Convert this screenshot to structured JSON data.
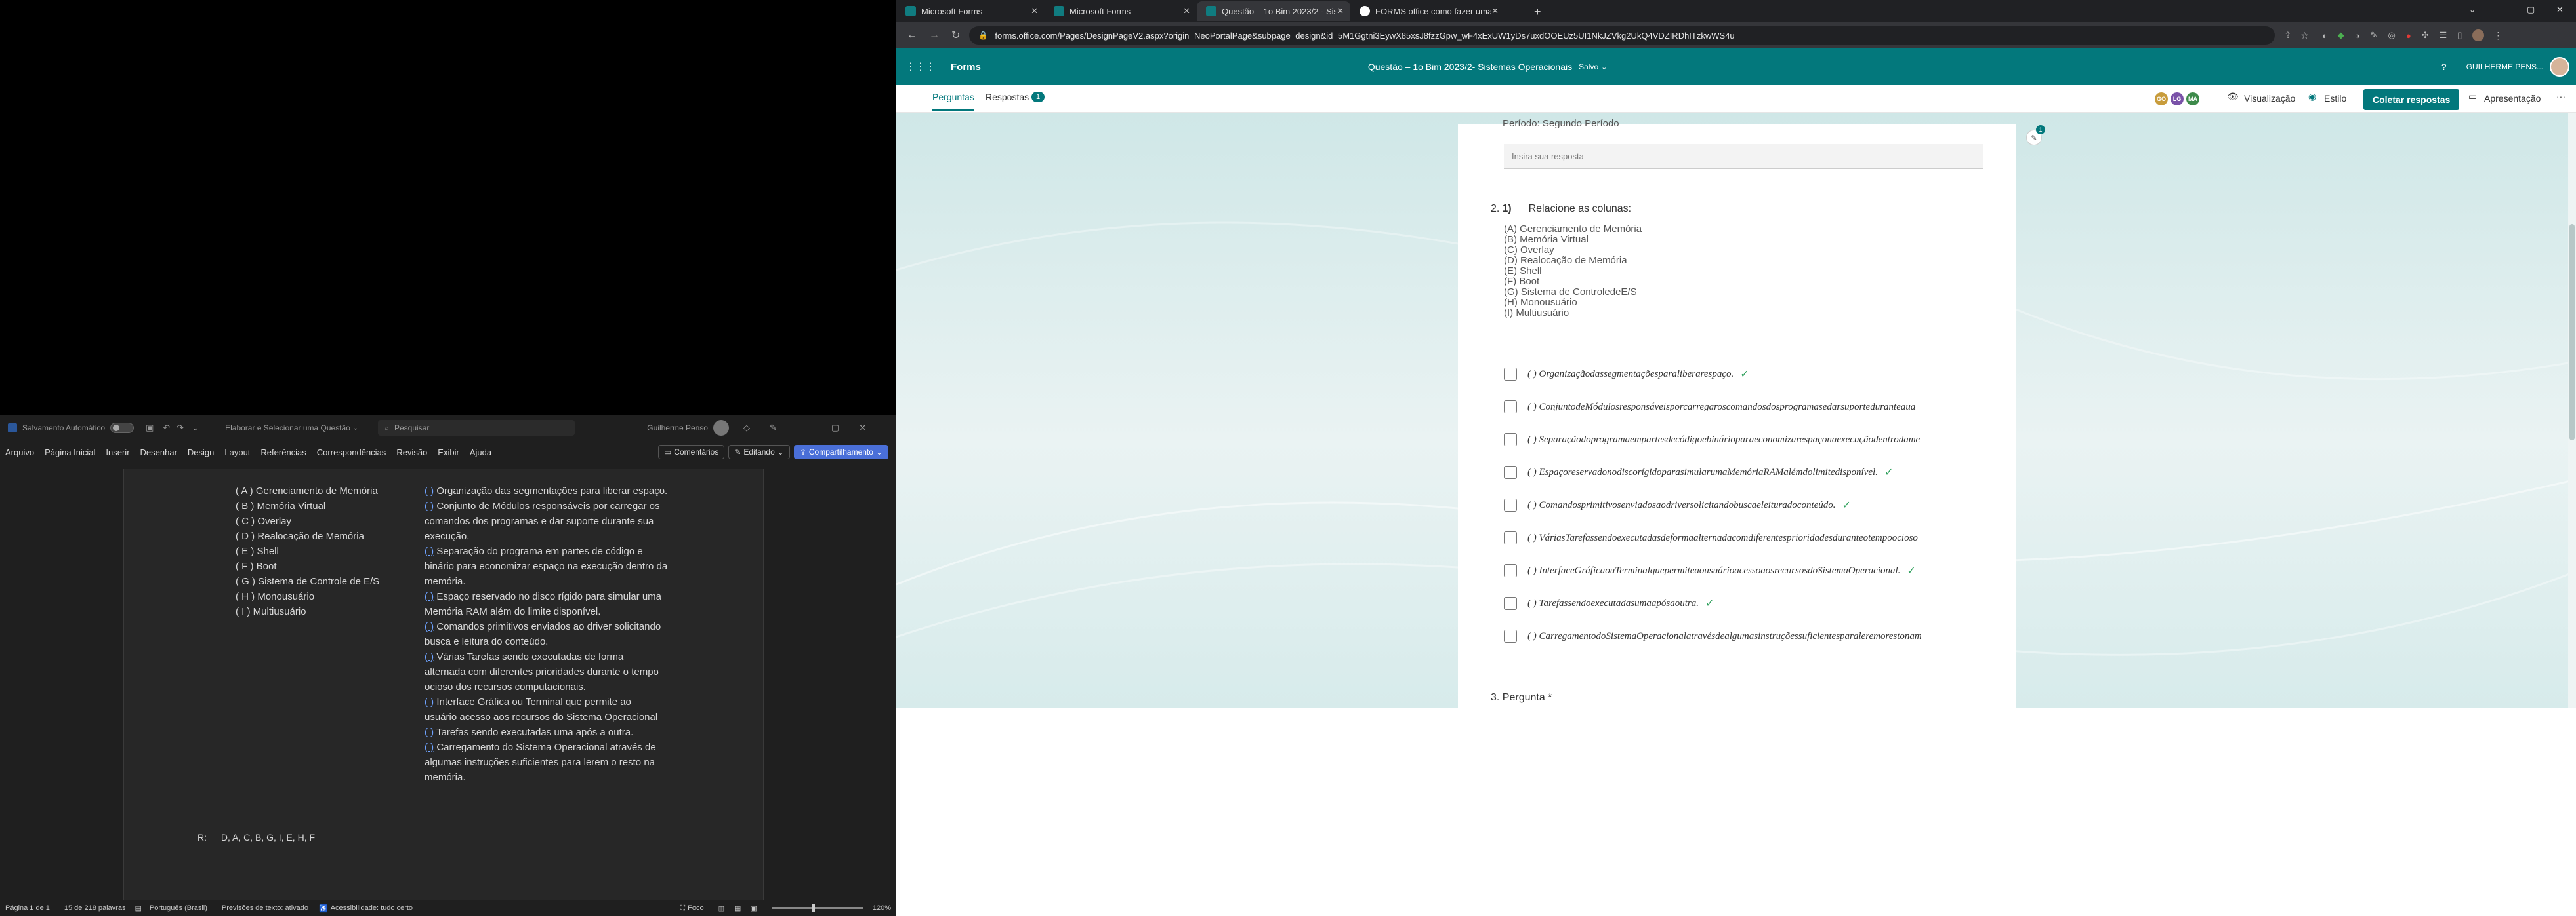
{
  "word": {
    "title": {
      "autosave": "Salvamento Automático",
      "doc_name": "Elaborar e Selecionar uma Questão",
      "search_placeholder": "Pesquisar",
      "user": "Guilherme Penso"
    },
    "ribbon": {
      "tabs": [
        "Arquivo",
        "Página Inicial",
        "Inserir",
        "Desenhar",
        "Design",
        "Layout",
        "Referências",
        "Correspondências",
        "Revisão",
        "Exibir",
        "Ajuda"
      ],
      "comments": "Comentários",
      "editing": "Editando",
      "share": "Compartilhamento"
    },
    "doc": {
      "left_items": [
        "( A ) Gerenciamento de Memória",
        "( B ) Memória Virtual",
        "( C ) Overlay",
        "( D ) Realocação de Memória",
        "( E ) Shell",
        "( F ) Boot",
        "( G ) Sistema de Controle de E/S",
        "( H ) Monousuário",
        "( I ) Multiusuário"
      ],
      "right_lines": [
        "(     ) Organização das segmentações para liberar espaço.",
        "(     ) Conjunto de Módulos responsáveis por carregar os",
        "comandos dos programas e dar suporte durante sua",
        "execução.",
        "(     ) Separação do programa em partes de código e",
        "binário para economizar espaço na execução dentro da",
        "memória.",
        "(     ) Espaço reservado no disco rígido para simular uma",
        "Memória RAM além do limite disponível.",
        "(     ) Comandos primitivos enviados ao driver solicitando",
        "busca e leitura do conteúdo.",
        "(     ) Várias Tarefas sendo executadas de forma",
        "alternada com diferentes prioridades durante o tempo",
        "ocioso dos recursos computacionais.",
        "(     ) Interface Gráfica ou Terminal que permite ao",
        "usuário acesso aos recursos do Sistema Operacional",
        "(     ) Tarefas sendo executadas uma após a outra.",
        "(     ) Carregamento do Sistema Operacional através de",
        "algumas instruções suficientes para lerem o resto na",
        "memória."
      ],
      "answer_label": "R:",
      "answer": "D, A, C, B, G, I, E, H, F"
    },
    "status": {
      "page": "Página 1 de 1",
      "words": "15 de 218 palavras",
      "lang": "Português (Brasil)",
      "predictions": "Previsões de texto: ativado",
      "accessibility": "Acessibilidade: tudo certo",
      "focus": "Foco",
      "zoom": "120%"
    }
  },
  "browser": {
    "tabs": [
      {
        "title": "Microsoft Forms"
      },
      {
        "title": "Microsoft Forms"
      },
      {
        "title": "Questão – 1o Bim 2023/2 - Sistem"
      },
      {
        "title": "FORMS office como fazer uma re"
      }
    ],
    "url": "forms.office.com/Pages/DesignPageV2.aspx?origin=NeoPortalPage&subpage=design&id=5M1Ggtni3EywX85xsJ8fzzGpw_wF4xExUW1yDs7uxdOOEUz5UI1NkJZVkg2UkQ4VDZIRDhITzkwWS4u",
    "app": {
      "name": "Forms",
      "form_title": "Questão – 1o Bim 2023/2- Sistemas Operacionais",
      "saved": "Salvo",
      "help": "?",
      "user": "GUILHERME PENS..."
    },
    "subbar": {
      "tab_questions": "Perguntas",
      "tab_responses": "Respostas",
      "responses_count": "1",
      "avatars": [
        "GO",
        "LG",
        "MA"
      ],
      "preview": "Visualização",
      "style": "Estilo",
      "collect": "Coletar respostas",
      "present": "Apresentação",
      "more": "···"
    },
    "form": {
      "prev_title": "Período: Segundo Período",
      "prev_placeholder": "Insira sua resposta",
      "q_num": "2.",
      "q_bold": "1)",
      "q_title": "Relacione as colunas:",
      "q_lines": [
        "(A) Gerenciamento de Memória",
        "(B) Memória Virtual",
        "(C) Overlay",
        "(D) Realocação de Memória",
        "(E) Shell",
        "(F) Boot",
        "(G) Sistema de ControledeE/S",
        "(H) Monousuário",
        "(I) Multiusuário"
      ],
      "options": [
        {
          "text": "( ) Organizaçãodassegmentaçõesparaliberarespaço.",
          "checked": true
        },
        {
          "text": "( ) ConjuntodeMódulosresponsáveisporcarregaroscomandosdosprogramasedarsuporteduranteaua",
          "checked": false
        },
        {
          "text": "( ) Separaçãodoprogramaempartesdecódigoebinárioparaeconomizarespaçonaexecuçãodentrodame",
          "checked": false
        },
        {
          "text": "( ) EspaçoreservadonodiscorígidoparasimularumaMemóriaRAMalémdolimitedisponível.",
          "checked": true
        },
        {
          "text": "( ) Comandosprimitivosenviadosaodriversolicitandobuscaeleituradoconteúdo.",
          "checked": true
        },
        {
          "text": "( ) VáriasTarefassendoexecutadasdeformaalternadacomdiferentesprioridadesduranteotempoocioso",
          "checked": false
        },
        {
          "text": "( ) InterfaceGráficaouTerminalquepermiteaousuárioacessoaosrecursosdoSistemaOperacional.",
          "checked": true
        },
        {
          "text": "( ) Tarefassendoexecutadasumaapósaoutra.",
          "checked": true
        },
        {
          "text": "( ) CarregamentodoSistemaOperacionalatravésdealgumasinstruçõessuficientesparaleremorestonam",
          "checked": false
        }
      ],
      "next_question": "3. Pergunta *",
      "badge": "1"
    }
  },
  "colors": {
    "forms_teal": "#03787c",
    "word_bg": "#1f1f1f",
    "check_green": "#2fa05c"
  }
}
